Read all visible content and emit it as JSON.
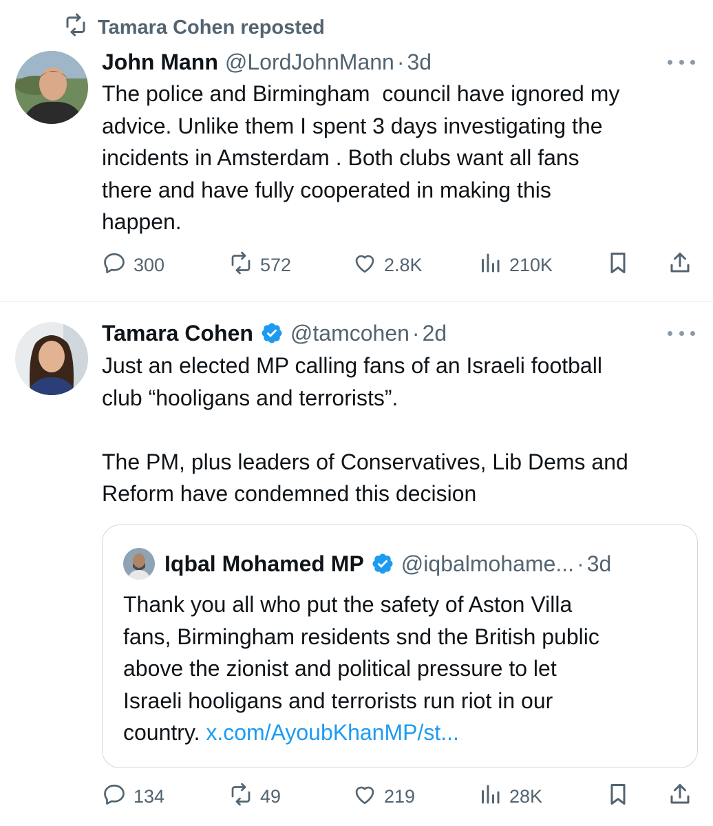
{
  "repost_banner": {
    "text": "Tamara Cohen reposted"
  },
  "tweets": [
    {
      "name": "John Mann",
      "handle": "@LordJohnMann",
      "time": "3d",
      "verified": false,
      "text": "The police and Birmingham  council have ignored my\nadvice. Unlike them I spent 3 days investigating the\nincidents in Amsterdam . Both clubs want all fans\nthere and have fully cooperated in making this\nhappen.",
      "stats": {
        "replies": "300",
        "reposts": "572",
        "likes": "2.8K",
        "views": "210K"
      }
    },
    {
      "name": "Tamara Cohen",
      "handle": "@tamcohen",
      "time": "2d",
      "verified": true,
      "text": "Just an elected MP calling fans of an Israeli football\nclub “hooligans and terrorists”.\n\nThe PM, plus leaders of Conservatives, Lib Dems and\nReform have condemned this decision",
      "quote": {
        "name": "Iqbal Mohamed MP",
        "handle": "@iqbalmohame...",
        "time": "3d",
        "verified": true,
        "text": "Thank you all who put the safety of Aston Villa\nfans, Birmingham residents snd the British public\nabove the zionist and political pressure to let\nIsraeli hooligans and terrorists run riot in our\ncountry. ",
        "link": "x.com/AyoubKhanMP/st..."
      },
      "stats": {
        "replies": "134",
        "reposts": "49",
        "likes": "219",
        "views": "28K"
      }
    }
  ],
  "separator": "·",
  "icons": {
    "repost": "repost-icon",
    "reply": "reply-icon",
    "like": "heart-icon",
    "views": "views-chart-icon",
    "bookmark": "bookmark-icon",
    "share": "share-icon",
    "more": "more-dots-icon",
    "verified": "verified-badge-icon"
  },
  "colors": {
    "text": "#0f1419",
    "secondary": "#536471",
    "link": "#1d9bf0",
    "verified": "#1d9bf0",
    "border": "#cfd9de"
  }
}
